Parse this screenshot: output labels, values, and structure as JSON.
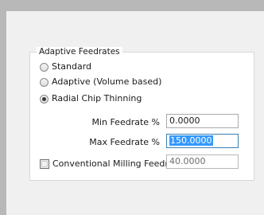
{
  "group": {
    "title": "Adaptive Feedrates"
  },
  "radios": [
    {
      "label": "Standard",
      "checked": false
    },
    {
      "label": "Adaptive (Volume based)",
      "checked": false
    },
    {
      "label": "Radial Chip Thinning",
      "checked": true
    }
  ],
  "fields": {
    "min_feedrate": {
      "label": "Min Feedrate %",
      "value": "0.0000"
    },
    "max_feedrate": {
      "label": "Max Feedrate %",
      "value": "150.0000"
    },
    "conventional": {
      "label": "Conventional Milling Feedrate",
      "value": "40.0000",
      "checked": false
    }
  }
}
